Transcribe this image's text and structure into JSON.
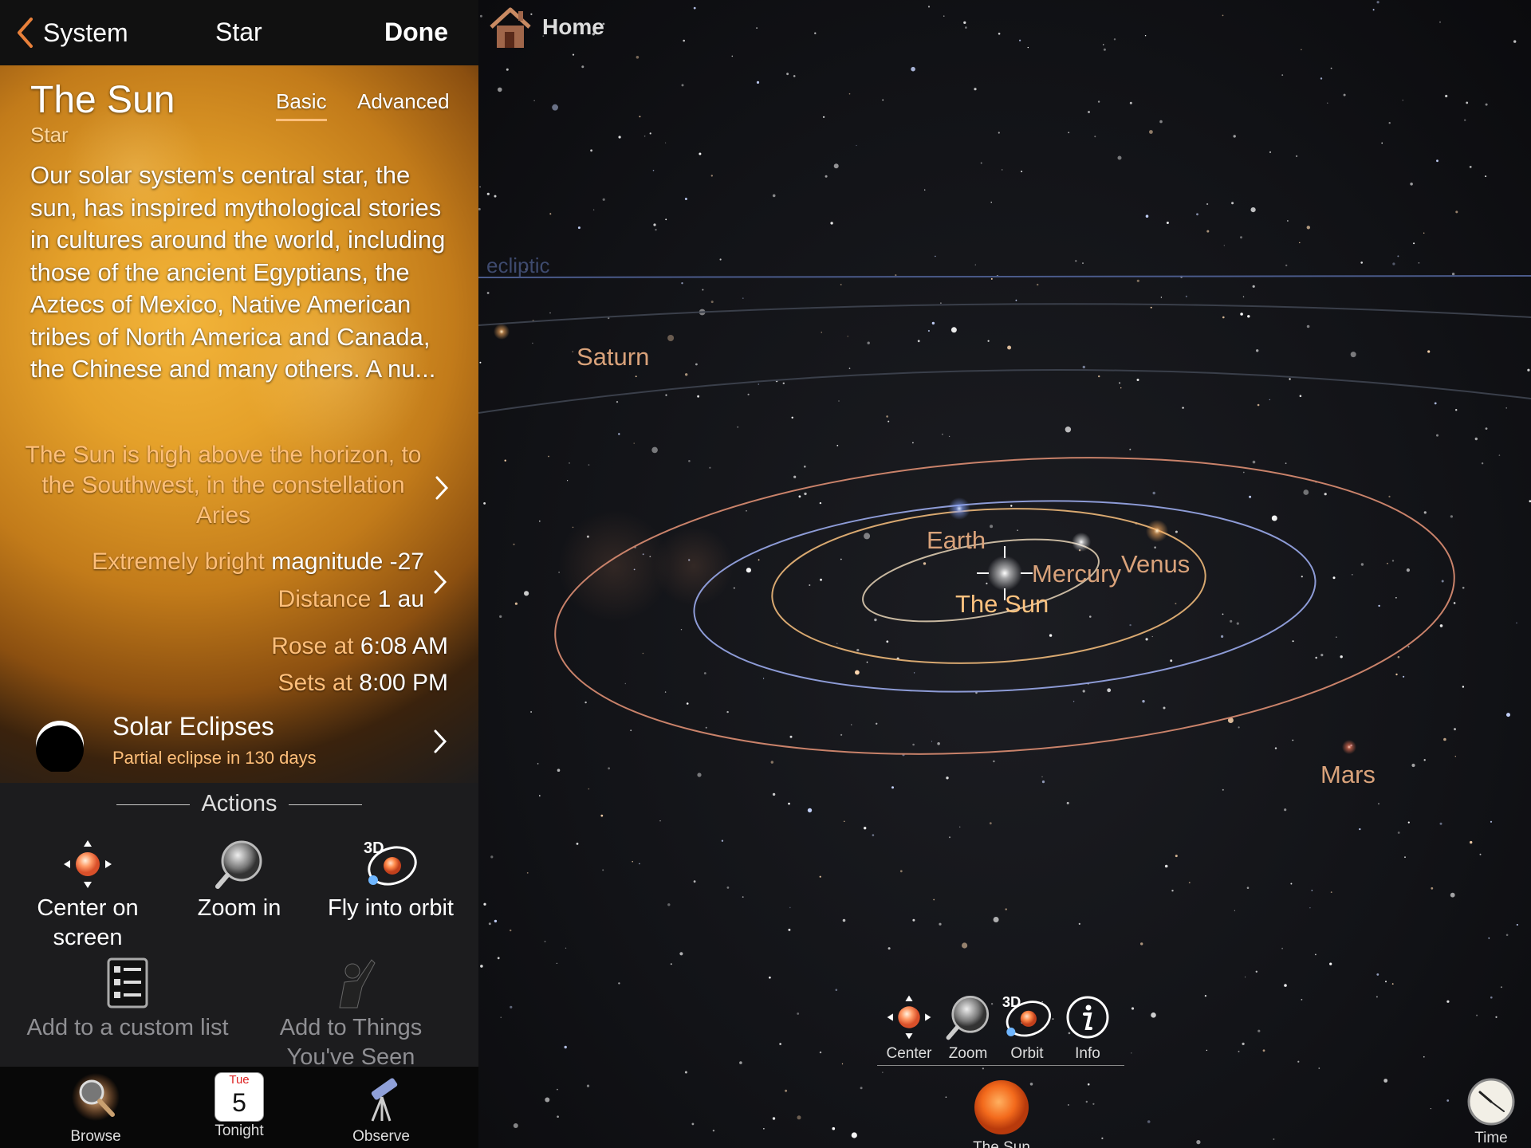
{
  "nav": {
    "back_label": "System",
    "title": "Star",
    "done_label": "Done"
  },
  "object": {
    "name": "The Sun",
    "type": "Star",
    "tabs": [
      "Basic",
      "Advanced"
    ],
    "selected_tab": "Basic",
    "description": "Our solar system's central star, the sun, has inspired mythological stories in cultures around the world, including those of the ancient Egyptians, the Aztecs of Mexico, Native American tribes of North America and Canada, the Chinese and many others. A nu...",
    "position_text": "The Sun is high above the horizon, to the Southwest, in the constellation Aries",
    "brightness_label": "Extremely bright",
    "magnitude_label": "magnitude -27",
    "distance_key": "Distance",
    "distance_value": "1 au",
    "rise_key": "Rose at",
    "rise_value": "6:08 AM",
    "set_key": "Sets at",
    "set_value": "8:00 PM"
  },
  "eclipse": {
    "title": "Solar Eclipses",
    "subtitle": "Partial eclipse in 130 days"
  },
  "actions": {
    "header": "Actions",
    "center": "Center on screen",
    "zoom": "Zoom in",
    "orbit": "Fly into orbit",
    "orbit_badge": "3D",
    "custom_list": "Add to a custom list",
    "things_seen": "Add to Things You've Seen"
  },
  "tabbar": {
    "browse": "Browse",
    "tonight": "Tonight",
    "tonight_day": "Tue",
    "tonight_date": "5",
    "observe": "Observe"
  },
  "sky": {
    "home_label": "Home",
    "ecliptic_label": "ecliptic",
    "planet_labels": {
      "saturn": "Saturn",
      "earth": "Earth",
      "mercury": "Mercury",
      "venus": "Venus",
      "sun": "The Sun",
      "mars": "Mars"
    },
    "tools": {
      "center": "Center",
      "zoom": "Zoom",
      "orbit": "Orbit",
      "orbit_badge": "3D",
      "info": "Info"
    },
    "selected_object": "The Sun",
    "time_label": "Time"
  },
  "colors": {
    "accent_orange": "#ffbf7a",
    "panel_bg": "#1c1c1e",
    "mars_orbit": "#c9826a",
    "earth_orbit": "#8d9bd6",
    "venus_orbit": "#d8a870",
    "mercury_orbit": "#c8b8a0"
  },
  "icons": {
    "back": "chevron-left-icon",
    "home": "house-icon",
    "center": "center-crosshair-icon",
    "zoom": "magnifier-icon",
    "orbit": "orbit-3d-icon",
    "info": "info-icon",
    "eclipse": "eclipse-icon",
    "list": "checklist-icon",
    "observer": "observer-pointing-icon",
    "browse": "magnifier-icon",
    "tonight": "calendar-icon",
    "observe": "telescope-icon",
    "time": "clock-icon"
  }
}
